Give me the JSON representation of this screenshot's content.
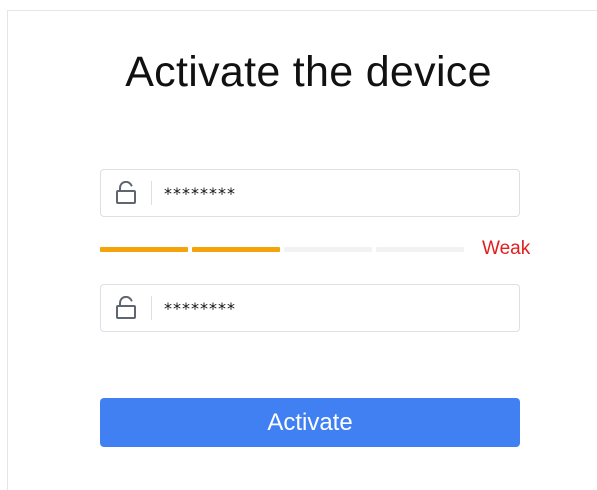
{
  "page": {
    "title": "Activate the device"
  },
  "form": {
    "password": {
      "value": "********",
      "icon": "unlock-icon"
    },
    "confirm_password": {
      "value": "********",
      "icon": "unlock-icon"
    },
    "strength": {
      "label": "Weak",
      "level": 2,
      "max_level": 4,
      "color": "#f5a30a",
      "label_color": "#e21d1d"
    },
    "submit_label": "Activate"
  },
  "colors": {
    "accent": "#4080f2"
  }
}
